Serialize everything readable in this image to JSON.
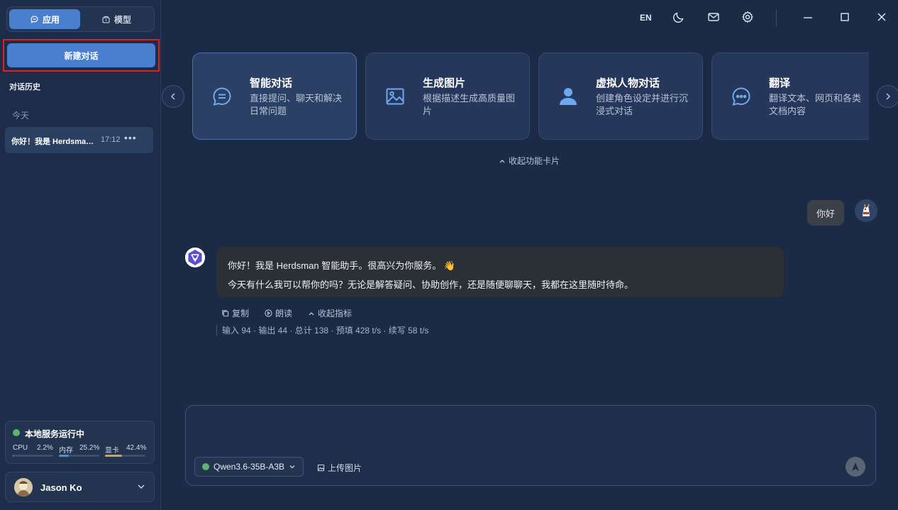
{
  "sidebar": {
    "tabs": [
      {
        "label": "应用",
        "icon": "chat-bubble-icon"
      },
      {
        "label": "模型",
        "icon": "box-icon"
      }
    ],
    "new_chat_label": "新建对话",
    "history_title": "对话历史",
    "today_label": "今天",
    "history_items": [
      {
        "title": "你好！我是 Herdsman 智能助手",
        "time": "17:12",
        "more": "•••"
      }
    ],
    "status": {
      "title": "本地服务运行中",
      "status_color": "#5fb36a",
      "metrics": [
        {
          "label": "CPU",
          "value": "2.2%",
          "fraction": 0.022,
          "color": "#4a8fd8"
        },
        {
          "label": "内存",
          "value": "25.2%",
          "fraction": 0.252,
          "color": "#4a8fd8"
        },
        {
          "label": "显卡",
          "value": "42.4%",
          "fraction": 0.424,
          "color": "#e0a040"
        }
      ]
    },
    "user": {
      "name": "Jason Ko"
    }
  },
  "topbar": {
    "lang": "EN",
    "icons": [
      "moon-icon",
      "mail-icon",
      "gear-icon",
      "minimize-icon",
      "maximize-icon",
      "close-icon"
    ]
  },
  "cards": [
    {
      "title": "智能对话",
      "desc": "直接提问、聊天和解决日常问题",
      "icon": "chat-lines-icon"
    },
    {
      "title": "生成图片",
      "desc": "根据描述生成高质量图片",
      "icon": "image-icon"
    },
    {
      "title": "虚拟人物对话",
      "desc": "创建角色设定并进行沉浸式对话",
      "icon": "person-icon"
    },
    {
      "title": "翻译",
      "desc": "翻译文本、网页和各类文档内容",
      "icon": "chat-dots-icon"
    }
  ],
  "collapse_cards_label": "收起功能卡片",
  "chat": {
    "user_message": "你好",
    "bot_lines": [
      "你好！我是 Herdsman 智能助手。很高兴为你服务。 👋",
      "今天有什么我可以帮你的吗？无论是解答疑问、协助创作，还是随便聊聊天，我都在这里随时待命。"
    ],
    "actions": {
      "copy": "复制",
      "read": "朗读",
      "collapse_metrics": "收起指标"
    },
    "metrics": "输入 94 · 输出 44 · 总计 138 · 预填 428 t/s · 续写 58 t/s"
  },
  "input": {
    "placeholder": "",
    "model": "Qwen3.6-35B-A3B",
    "upload_label": "上传图片"
  },
  "colors": {
    "accent": "#4a7fd0",
    "background": "#1b2a45",
    "highlight_border": "#e02020"
  }
}
